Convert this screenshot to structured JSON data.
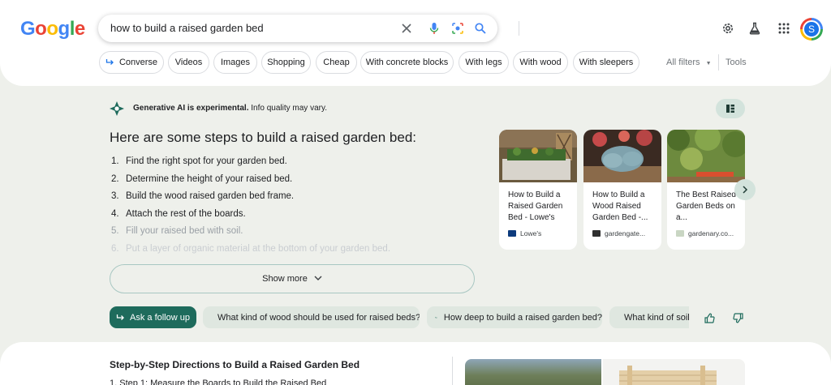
{
  "header": {
    "logo": "Google",
    "search_query": "how to build a raised garden bed",
    "avatar_letter": "S"
  },
  "chips": [
    {
      "label": "Converse"
    },
    {
      "label": "Videos"
    },
    {
      "label": "Images"
    },
    {
      "label": "Shopping"
    },
    {
      "label": "Cheap"
    },
    {
      "label": "With concrete blocks"
    },
    {
      "label": "With legs"
    },
    {
      "label": "With wood"
    },
    {
      "label": "With sleepers"
    }
  ],
  "filters": {
    "all_filters": "All filters",
    "tools": "Tools"
  },
  "ai": {
    "note_bold": "Generative AI is experimental.",
    "note_rest": " Info quality may vary.",
    "heading": "Here are some steps to build a raised garden bed:",
    "steps": [
      "Find the right spot for your garden bed.",
      "Determine the height of your raised bed.",
      "Build the wood raised garden bed frame.",
      "Attach the rest of the boards.",
      "Fill your raised bed with soil.",
      "Put a layer of organic material at the bottom of your garden bed."
    ],
    "show_more": "Show more",
    "cards": [
      {
        "title": "How to Build a Raised Garden Bed - Lowe's",
        "source": "Lowe's"
      },
      {
        "title": "How to Build a Wood Raised Garden Bed -...",
        "source": "gardengate..."
      },
      {
        "title": "The Best Raised Garden Beds on a...",
        "source": "gardenary.co..."
      }
    ],
    "followup": "Ask a follow up",
    "questions": [
      "What kind of wood should be used for raised beds?",
      "How deep to build a raised garden bed?",
      "What kind of soil"
    ]
  },
  "lower": {
    "title": "Step-by-Step Directions to Build a Raised Garden Bed",
    "first_step": "1. Step 1: Measure the Boards to Build the Raised Bed"
  },
  "colors": {
    "accent_green": "#1e6b5c",
    "chip_green": "#dfe7e0",
    "bg": "#eef0eb"
  }
}
